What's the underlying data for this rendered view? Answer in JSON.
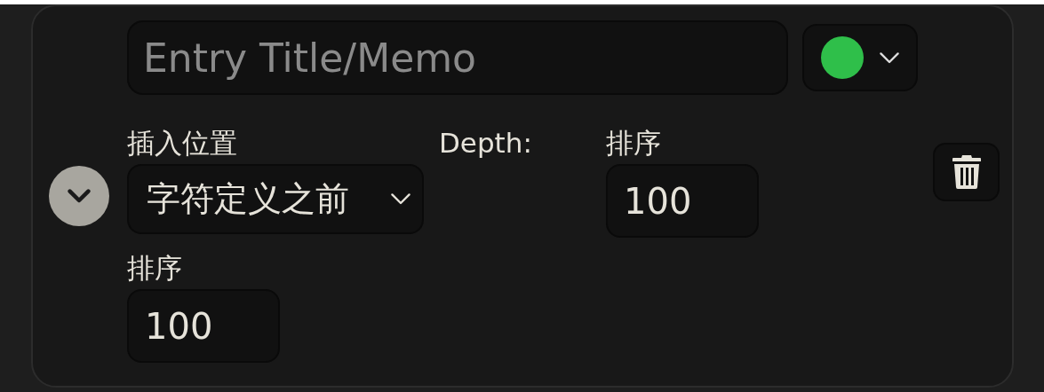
{
  "entry": {
    "title_placeholder": "Entry Title/Memo",
    "status": {
      "color": "#2fbf4a"
    },
    "position": {
      "label": "插入位置",
      "value": "字符定义之前"
    },
    "depth": {
      "label": "Depth:"
    },
    "order_inline": {
      "label": "排序",
      "value": "100"
    },
    "order": {
      "label": "排序",
      "value": "100"
    }
  }
}
